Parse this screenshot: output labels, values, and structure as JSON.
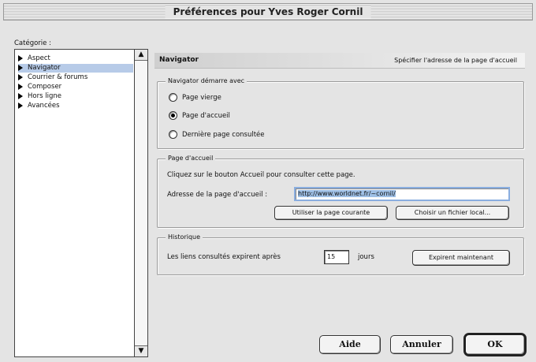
{
  "window": {
    "title": "Préférences pour Yves Roger Cornil"
  },
  "sidebar": {
    "label": "Catégorie :",
    "items": [
      {
        "label": "Aspect",
        "selected": false
      },
      {
        "label": "Navigator",
        "selected": true
      },
      {
        "label": "Courrier & forums",
        "selected": false
      },
      {
        "label": "Composer",
        "selected": false
      },
      {
        "label": "Hors ligne",
        "selected": false
      },
      {
        "label": "Avancées",
        "selected": false
      }
    ],
    "scroll_up_icon": "arrow-up-icon",
    "scroll_down_icon": "arrow-down-icon"
  },
  "panel": {
    "title": "Navigator",
    "description": "Spécifier l'adresse de la page d'accueil"
  },
  "startup": {
    "group_label": "Navigator démarre avec",
    "options": [
      {
        "label": "Page vierge",
        "checked": false
      },
      {
        "label": "Page d'accueil",
        "checked": true
      },
      {
        "label": "Dernière page consultée",
        "checked": false
      }
    ]
  },
  "home": {
    "group_label": "Page d'accueil",
    "instructions": "Cliquez sur le bouton Accueil pour consulter cette page.",
    "address_label": "Adresse de la page d'accueil :",
    "address_value": "http://www.worldnet.fr/~cornil/",
    "use_current_label": "Utiliser la page courante",
    "choose_file_label": "Choisir un fichier local..."
  },
  "history": {
    "group_label": "Historique",
    "expire_label": "Les liens consultés expirent après",
    "days_value": "15",
    "days_unit": "jours",
    "expire_now_label": "Expirent maintenant"
  },
  "footer": {
    "help_label": "Aide",
    "cancel_label": "Annuler",
    "ok_label": "OK"
  },
  "colors": {
    "selection": "#b7cbe8",
    "url_highlight": "#9fc0e6"
  }
}
